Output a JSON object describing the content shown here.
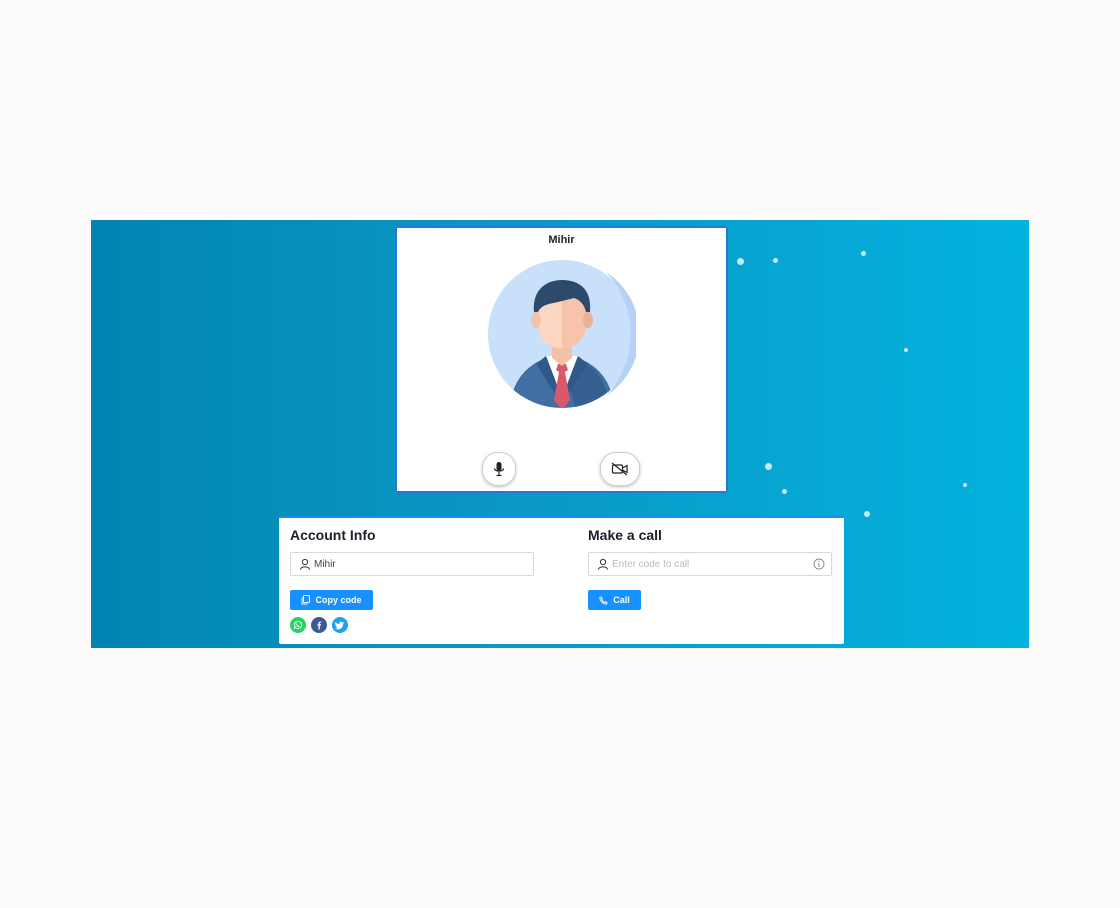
{
  "video": {
    "caller_name": "Mihir"
  },
  "account_info": {
    "title": "Account Info",
    "name_value": "Mihir",
    "copy_button_label": "Copy code",
    "share_icons": [
      "whatsapp-icon",
      "facebook-icon",
      "twitter-icon"
    ]
  },
  "make_call": {
    "title": "Make a call",
    "code_placeholder": "Enter code to call",
    "code_value": "",
    "call_button_label": "Call"
  },
  "colors": {
    "accent": "#1890ff",
    "background_start": "#0284b0",
    "background_end": "#03b2de",
    "whatsapp": "#25d366",
    "facebook": "#3b5998",
    "twitter": "#1da1f2"
  }
}
